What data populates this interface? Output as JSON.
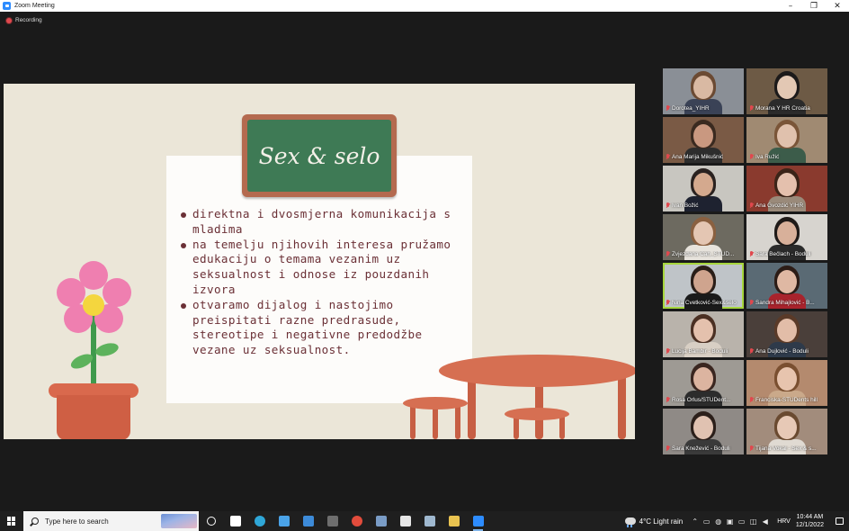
{
  "window": {
    "title": "Zoom Meeting",
    "minimize": "–",
    "maximize": "❐",
    "close": "✕"
  },
  "recording": {
    "label": "Recording"
  },
  "slide": {
    "title": "Sex & selo",
    "bullets": [
      "direktna i dvosmjerna komunikacija s mladima",
      "na temelju njihovih interesa pružamo edukaciju o temama vezanim uz seksualnost i odnose iz pouzdanih izvora",
      "otvaramo dijalog i nastojimo preispitati razne predrasude, stereotipe i negativne predodžbe vezane uz seksualnost."
    ]
  },
  "participants": [
    {
      "name": "Dorotea_YIHR",
      "bg": "#8a8f96",
      "skin": "#d9b9a3",
      "hair": "#6b4a33",
      "shirt": "#3a4256"
    },
    {
      "name": "Morana Y HR Croatia",
      "bg": "#6d5a45",
      "skin": "#e3c8b4",
      "hair": "#1c1a1a",
      "shirt": "#2b2b2b"
    },
    {
      "name": "Ana Marija Mikušnić",
      "bg": "#7a5a45",
      "skin": "#c99880",
      "hair": "#3a2a20",
      "shirt": "#2d2d2d"
    },
    {
      "name": "Iva Ružić",
      "bg": "#a08a72",
      "skin": "#e0c1ad",
      "hair": "#7a5538",
      "shirt": "#3c5c4a"
    },
    {
      "name": "Ivan Božić",
      "bg": "#c8c6c0",
      "skin": "#d4a98e",
      "hair": "#2a2220",
      "shirt": "#1e2230"
    },
    {
      "name": "Ana Gvozdić YIHR",
      "bg": "#8a3a2e",
      "skin": "#e4c0ad",
      "hair": "#3b2418",
      "shirt": "#9a8a7a"
    },
    {
      "name": "Zvjezdana Čah_STUD...",
      "bg": "#6d6a60",
      "skin": "#e4c6b3",
      "hair": "#8a6040",
      "shirt": "#e7e3dc"
    },
    {
      "name": "Sara Bečlach - Boduli",
      "bg": "#d7d4cf",
      "skin": "#d8b09a",
      "hair": "#1f1a18",
      "shirt": "#2a2a2a"
    },
    {
      "name": "Nina Cvetković-Sex&selo",
      "bg": "#bfc4c8",
      "skin": "#cfa48e",
      "hair": "#2a1e18",
      "shirt": "#1a1a1a"
    },
    {
      "name": "Sandra Mihajlović - B...",
      "bg": "#5a6a74",
      "skin": "#dfb8a3",
      "hair": "#2c1c16",
      "shirt": "#a8232c"
    },
    {
      "name": "Lucija Bambir - Boduli",
      "bg": "#b9b3ab",
      "skin": "#e4c1ad",
      "hair": "#4b3023",
      "shirt": "#d8cfc4"
    },
    {
      "name": "Ana Dujlović - Boduli",
      "bg": "#4a3f3a",
      "skin": "#e2bda8",
      "hair": "#5a3a28",
      "shirt": "#2e3a4a"
    },
    {
      "name": "Rosa Orlus/STUDent...",
      "bg": "#9e9a94",
      "skin": "#dcb4a0",
      "hair": "#3a2620",
      "shirt": "#2c2c2c"
    },
    {
      "name": "Franciska-STUDents hill",
      "bg": "#b48a6e",
      "skin": "#e7c4ae",
      "hair": "#7a4f30",
      "shirt": "#caa98a"
    },
    {
      "name": "Sara Knežević - Boduli",
      "bg": "#8f8a86",
      "skin": "#e0c2b1",
      "hair": "#2b1f1a",
      "shirt": "#3a3a3a"
    },
    {
      "name": "Tijana Vokal - Sex & s...",
      "bg": "#a28c7c",
      "skin": "#e7c9b6",
      "hair": "#6a4a30",
      "shirt": "#e0dad2"
    }
  ],
  "active_speaker_index": 8,
  "taskbar": {
    "search_placeholder": "Type here to search",
    "weather": "4°C  Light rain",
    "language": "HRV",
    "time": "10:44 AM",
    "date": "12/1/2022",
    "apps": [
      {
        "icon": "task-view-icon",
        "color": "#ffffff"
      },
      {
        "icon": "edge-icon",
        "color": "#2fa7d8"
      },
      {
        "icon": "store-icon",
        "color": "#4aa3e8"
      },
      {
        "icon": "mail-icon",
        "color": "#3d8bd9"
      },
      {
        "icon": "teams-like-icon",
        "color": "#6e6e6e"
      },
      {
        "icon": "chrome-icon",
        "color": "#e24c3c"
      },
      {
        "icon": "calculator-icon",
        "color": "#7a9cc6"
      },
      {
        "icon": "file-icon",
        "color": "#e6e6e6"
      },
      {
        "icon": "recycle-icon",
        "color": "#9fb8cf"
      },
      {
        "icon": "file-explorer-icon",
        "color": "#e9c350"
      },
      {
        "icon": "zoom-icon",
        "color": "#2d8cff"
      }
    ]
  }
}
